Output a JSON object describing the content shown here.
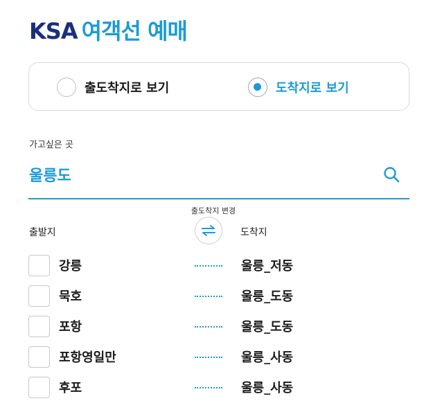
{
  "header": {
    "brand": "KSA",
    "title": "여객선 예매"
  },
  "view_mode": {
    "options": [
      {
        "label": "출도착지로 보기",
        "selected": false
      },
      {
        "label": "도착지로 보기",
        "selected": true
      }
    ]
  },
  "destination": {
    "label": "가고싶은 곳",
    "value": "울릉도"
  },
  "route_table": {
    "swap_caption": "출도착지 변경",
    "from_header": "출발지",
    "to_header": "도착지",
    "rows": [
      {
        "from": "강릉",
        "to": "울릉_저동",
        "checked": false
      },
      {
        "from": "묵호",
        "to": "울릉_도동",
        "checked": false
      },
      {
        "from": "포항",
        "to": "울릉_도동",
        "checked": false
      },
      {
        "from": "포항영일만",
        "to": "울릉_사동",
        "checked": false
      },
      {
        "from": "후포",
        "to": "울릉_사동",
        "checked": false
      }
    ]
  },
  "colors": {
    "accent": "#1a9bd7",
    "brand": "#1d2f7a"
  }
}
